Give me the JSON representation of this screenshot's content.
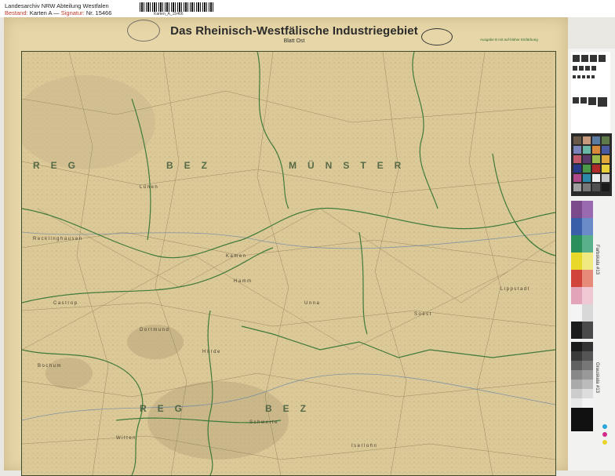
{
  "archive": {
    "line1": "Landesarchiv NRW Abteilung Westfalen",
    "line2_key1": "Bestand:",
    "line2_val1": "Karten A",
    "line2_sep": "—",
    "line2_key2": "Signatur:",
    "line2_val2": "Nr. 15466",
    "barcode_text": "Karten_A_15466"
  },
  "map": {
    "title": "Das Rheinisch-Westfälische Industriegebiet",
    "subtitle": "Blatt Ost",
    "edition_note": "Ausgabe B mit auf-blüher Einfärbung",
    "regions": [
      "REG",
      "BEZ",
      "MÜNSTER",
      "REG",
      "BEZ"
    ],
    "places": [
      "Recklinghausen",
      "Dortmund",
      "Bochum",
      "Lünen",
      "Kamen",
      "Witten",
      "Hörde",
      "Castrop",
      "Unna",
      "Schwerte",
      "Lippstadt",
      "Soest",
      "Iserlohn",
      "Hamm"
    ]
  },
  "calibration": {
    "label1": "Farbskala #13",
    "label2": "Grauskala #13",
    "colors": [
      "#7a4a8a",
      "#3b5ea8",
      "#2a8f5a",
      "#e8d82a",
      "#d0443b",
      "#e2a4b8",
      "#f4f4f4",
      "#1c1c1c"
    ]
  }
}
